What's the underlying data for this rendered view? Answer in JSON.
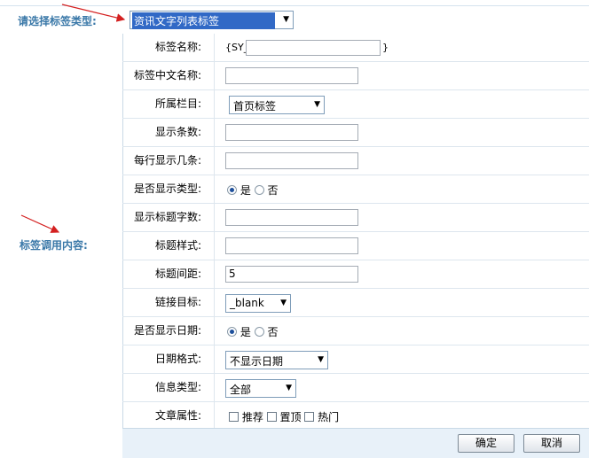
{
  "header": {
    "type_label": "请选择标签类型:",
    "type_select_value": "资讯文字列表标签"
  },
  "left": {
    "content_label": "标签调用内容:"
  },
  "form": {
    "tag_name": {
      "label": "标签名称:",
      "prefix": "{SY_",
      "suffix": "}",
      "value": ""
    },
    "tag_cn_name": {
      "label": "标签中文名称:",
      "value": ""
    },
    "column": {
      "label": "所属栏目:",
      "value": "首页标签"
    },
    "display_count": {
      "label": "显示条数:",
      "value": ""
    },
    "per_row": {
      "label": "每行显示几条:",
      "value": ""
    },
    "show_type": {
      "label": "是否显示类型:",
      "yes": "是",
      "no": "否",
      "selected": "是"
    },
    "title_chars": {
      "label": "显示标题字数:",
      "value": ""
    },
    "title_style": {
      "label": "标题样式:",
      "value": ""
    },
    "title_spacing": {
      "label": "标题间距:",
      "value": "5"
    },
    "link_target": {
      "label": "链接目标:",
      "value": "_blank"
    },
    "show_date": {
      "label": "是否显示日期:",
      "yes": "是",
      "no": "否",
      "selected": "是"
    },
    "date_format": {
      "label": "日期格式:",
      "value": "不显示日期"
    },
    "info_type": {
      "label": "信息类型:",
      "value": "全部"
    },
    "attributes": {
      "label": "文章属性:",
      "options": [
        "推荐",
        "置顶",
        "热门"
      ]
    }
  },
  "footer": {
    "confirm": "确定",
    "cancel": "取消"
  },
  "colors": {
    "label_blue": "#3a78a8",
    "arrow_red": "#d42020",
    "select_highlight": "#3169c6"
  }
}
